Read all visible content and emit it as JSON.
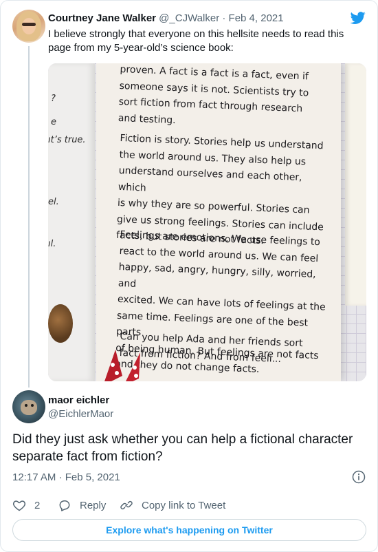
{
  "parent_tweet": {
    "author_name": "Courtney Jane Walker",
    "author_handle": "@_CJWalker",
    "separator": " · ",
    "date": "Feb 4, 2021",
    "text": "I believe strongly that everyone on this hellsite needs to read this page from my 5-year-old’s science book:",
    "photo": {
      "left_page_fragments": [
        "?",
        "e",
        "ıt’s true.",
        "el.",
        "ıl."
      ],
      "paragraphs": [
        "proven. A fact is a fact is a fact, even if\nsomeone says it is not. Scientists try to\nsort fiction from fact through research\nand testing.",
        "Fiction is story. Stories help us understand\nthe world around us. They also help us\nunderstand ourselves and each other, which\nis why they are so powerful. Stories can\ngive us strong feelings. Stories can include\nfacts, but stories are not facts.",
        "Feelings are emotions. We use feelings to\nreact to the world around us. We can feel\nhappy, sad, angry, hungry, silly, worried, and\nexcited. We can have lots of feelings at the\nsame time. Feelings are one of the best parts\nof being human. But feelings are not facts\nand they do not change facts.",
        "Can you help Ada and her friends sort\nfact from fiction? And from feeli..."
      ]
    }
  },
  "main_tweet": {
    "author_name": "maor eichler",
    "author_handle": "@EichlerMaor",
    "text": "Did they just ask whether you can help a fictional character separate fact from fiction?",
    "timestamp": "12:17 AM · Feb 5, 2021"
  },
  "actions": {
    "like_count": "2",
    "reply_label": "Reply",
    "copy_link_label": "Copy link to Tweet"
  },
  "explore_label": "Explore what's happening on Twitter",
  "colors": {
    "accent": "#1d9bf0",
    "secondary_text": "#536471",
    "border": "#cfd9de"
  },
  "icons": {
    "logo": "twitter-bird-icon",
    "info": "info-icon",
    "like": "heart-icon",
    "reply": "reply-bubble-icon",
    "copy_link": "link-icon"
  }
}
